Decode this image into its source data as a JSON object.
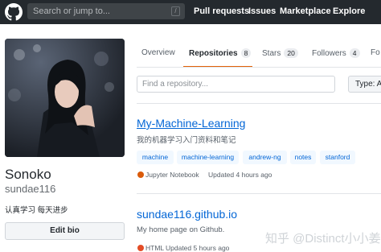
{
  "header": {
    "search_placeholder": "Search or jump to...",
    "search_shortcut": "/",
    "nav": [
      "Pull requests",
      "Issues",
      "Marketplace",
      "Explore"
    ]
  },
  "profile": {
    "name": "Sonoko",
    "login": "sundae116",
    "bio": "认真学习 每天进步",
    "edit_label": "Edit bio"
  },
  "tabs": [
    {
      "label": "Overview",
      "count": null
    },
    {
      "label": "Repositories",
      "count": "8"
    },
    {
      "label": "Stars",
      "count": "20"
    },
    {
      "label": "Followers",
      "count": "4"
    },
    {
      "label": "Fo",
      "count": null
    }
  ],
  "filter": {
    "placeholder": "Find a repository...",
    "type_label": "Type: A"
  },
  "repos": [
    {
      "name": "My-Machine-Learning",
      "description": "我的机器学习入门资料和笔记",
      "topics": [
        "machine",
        "machine-learning",
        "andrew-ng",
        "notes",
        "stanford"
      ],
      "language": "Jupyter Notebook",
      "language_color": "#DA5B0B",
      "updated": "Updated 4 hours ago"
    },
    {
      "name": "sundae116.github.io",
      "description": "My home page on Github.",
      "language": "HTML",
      "language_color": "#e34c26",
      "updated": "Updated 5 hours ago"
    }
  ],
  "watermark": "知乎 @Distinct小小姜",
  "colors": {
    "header_bg": "#24292e",
    "link": "#0366d6",
    "tab_accent": "#e36209"
  }
}
